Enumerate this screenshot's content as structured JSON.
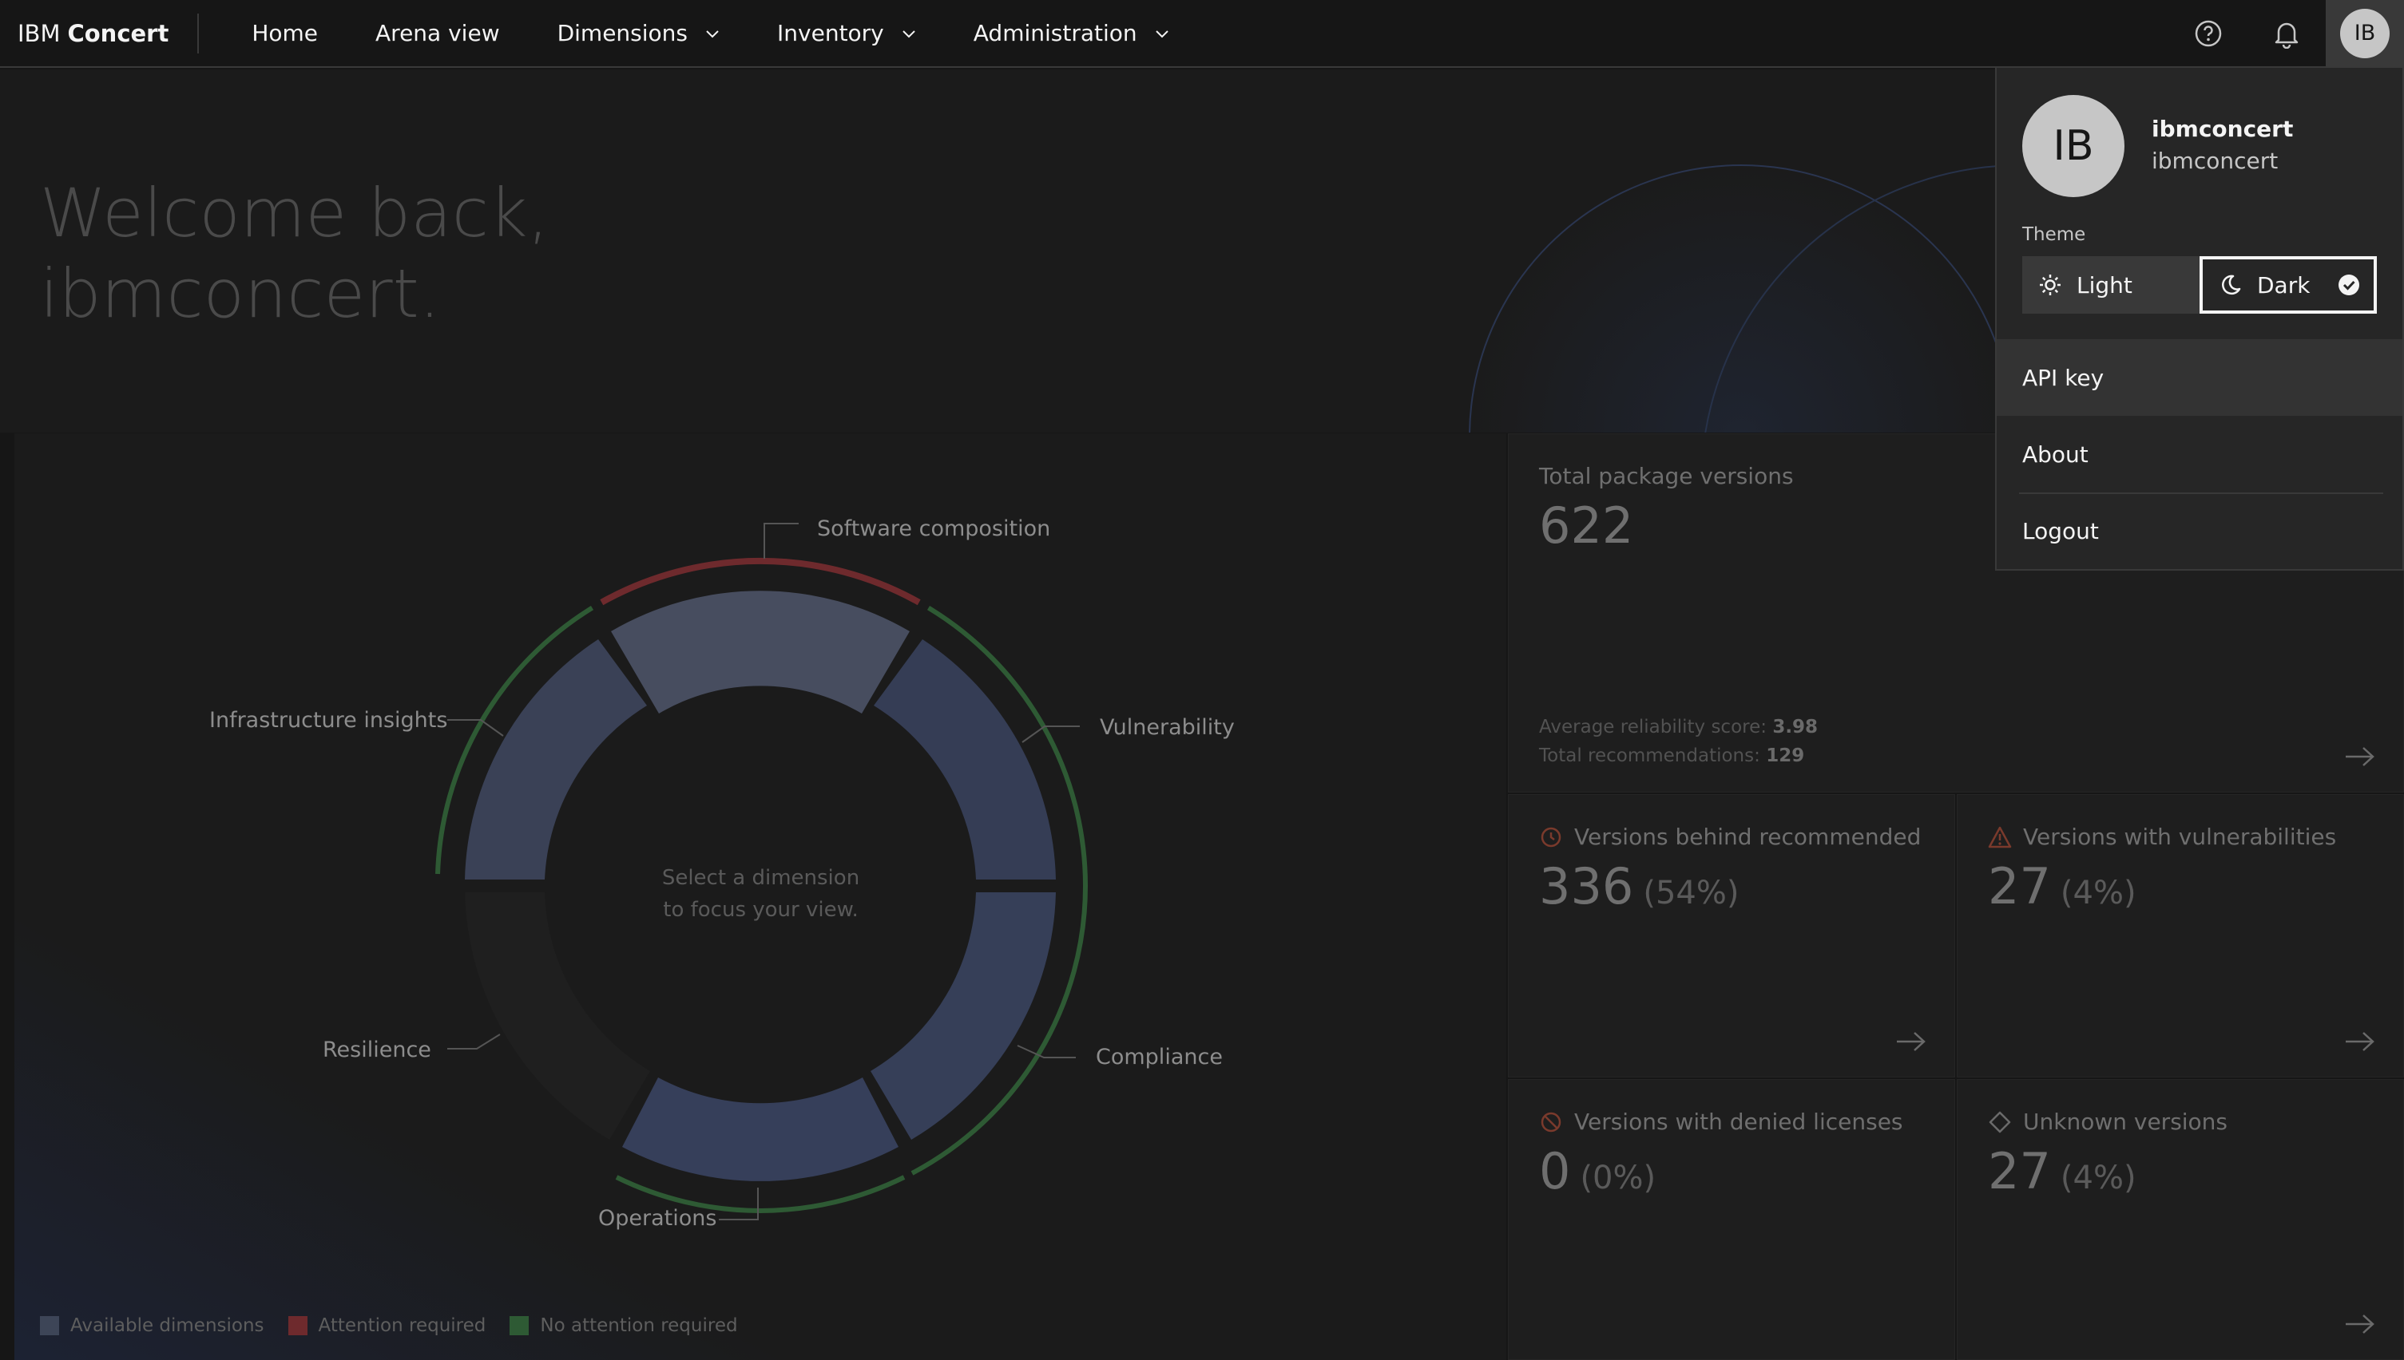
{
  "header": {
    "brand_prefix": "IBM",
    "brand_name": "Concert",
    "nav": [
      {
        "label": "Home"
      },
      {
        "label": "Arena view"
      },
      {
        "label": "Dimensions"
      },
      {
        "label": "Inventory"
      },
      {
        "label": "Administration"
      }
    ],
    "avatar_initials": "IB",
    "icons": [
      "help-icon",
      "notification-bell-icon"
    ]
  },
  "hero": {
    "welcome_line1": "Welcome back,",
    "welcome_line2": "ibmconcert."
  },
  "dimensions": {
    "labels": {
      "software_composition": "Software composition",
      "vulnerability": "Vulnerability",
      "compliance": "Compliance",
      "operations": "Operations",
      "resilience": "Resilience",
      "infrastructure": "Infrastructure insights"
    },
    "center_line1": "Select a dimension",
    "center_line2": "to focus your view.",
    "legend": [
      {
        "label": "Available dimensions",
        "color": "#3d4557"
      },
      {
        "label": "Attention required",
        "color": "#6e2a2d"
      },
      {
        "label": "No attention required",
        "color": "#2e5a34"
      }
    ]
  },
  "tiles": {
    "total": {
      "title": "Total package versions",
      "value": "622",
      "reliability_label": "Average reliability score:",
      "reliability_value": "3.98",
      "recommendations_label": "Total recommendations:",
      "recommendations_value": "129"
    },
    "behind": {
      "title": "Versions behind recommended",
      "value": "336",
      "pct": "(54%)"
    },
    "vulns": {
      "title": "Versions with vulnerabilities",
      "value": "27",
      "pct": "(4%)"
    },
    "denied": {
      "title": "Versions with denied licenses",
      "value": "0",
      "pct": "(0%)"
    },
    "unknown": {
      "title": "Unknown versions",
      "value": "27",
      "pct": "(4%)"
    }
  },
  "user_menu": {
    "avatar_initials": "IB",
    "display_name": "ibmconcert",
    "username": "ibmconcert",
    "theme_label": "Theme",
    "theme_light": "Light",
    "theme_dark": "Dark",
    "selected_theme": "Dark",
    "items": [
      {
        "label": "API key"
      },
      {
        "label": "About"
      },
      {
        "label": "Logout"
      }
    ]
  }
}
